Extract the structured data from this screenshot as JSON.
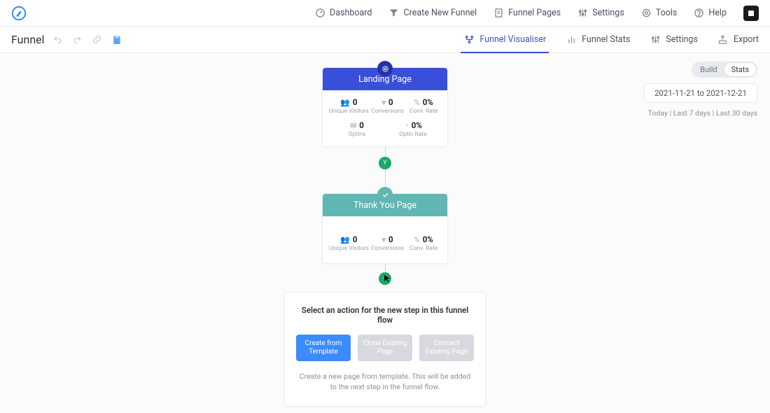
{
  "topnav": {
    "dashboard": "Dashboard",
    "create_funnel": "Create New Funnel",
    "funnel_pages": "Funnel Pages",
    "settings": "Settings",
    "tools": "Tools",
    "help": "Help"
  },
  "subbar": {
    "title": "Funnel",
    "visualiser": "Funnel Visualiser",
    "stats": "Funnel Stats",
    "settings": "Settings",
    "export": "Export"
  },
  "right": {
    "toggle_build": "Build",
    "toggle_stats": "Stats",
    "daterange": "2021-11-21 to 2021-12-21",
    "today": "Today",
    "last7": "Last 7 days",
    "last30": "Last 30 days",
    "sep": " | "
  },
  "flow": {
    "landing": {
      "title": "Landing Page",
      "unique_visitors_v": "0",
      "unique_visitors_l": "Unique Visitors",
      "conversions_v": "0",
      "conversions_l": "Conversions",
      "conv_rate_v": "0%",
      "conv_rate_l": "Conv. Rate",
      "optins_v": "0",
      "optins_l": "Optins",
      "optin_rate_v": "0%",
      "optin_rate_l": "Optin Rate"
    },
    "connector_label": "Y",
    "thankyou": {
      "title": "Thank You Page",
      "unique_visitors_v": "0",
      "unique_visitors_l": "Unique Visitors",
      "conversions_v": "0",
      "conversions_l": "Conversions",
      "conv_rate_v": "0%",
      "conv_rate_l": "Conv. Rate"
    },
    "plus_label": "+"
  },
  "action": {
    "title": "Select an action for the new step in this funnel flow",
    "btn_template": "Create from Template",
    "btn_clone": "Clone Existing Page",
    "btn_connect": "Connect Existing Page",
    "desc": "Create a new page from template. This will be added to the next step in the funnel flow."
  }
}
